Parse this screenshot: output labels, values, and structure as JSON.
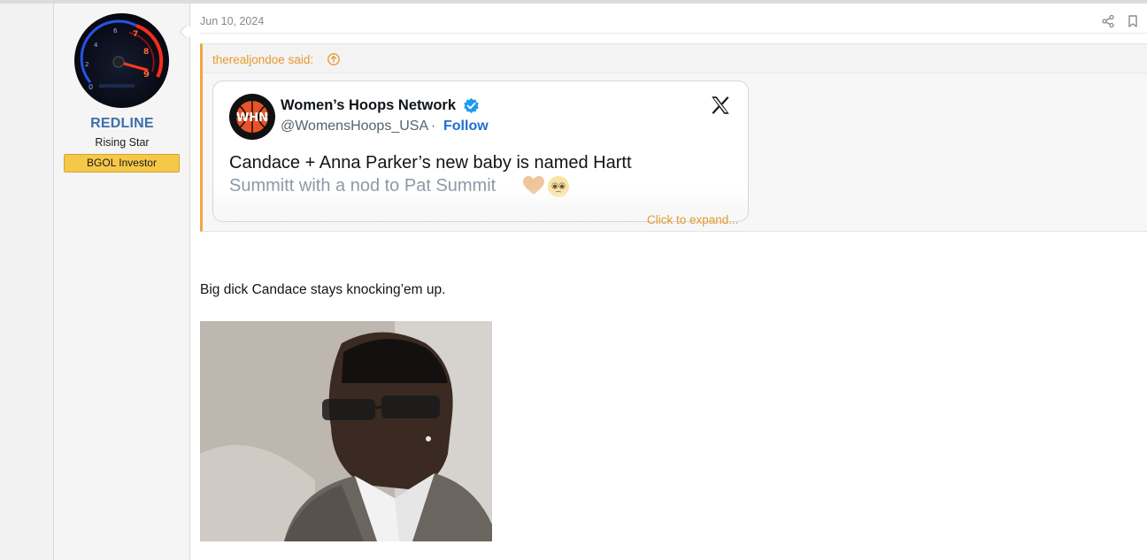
{
  "post": {
    "date": "Jun 10, 2024",
    "body_text": "Big dick Candace stays knocking’em up."
  },
  "user": {
    "name": "REDLINE",
    "title": "Rising Star",
    "banner": "BGOL Investor"
  },
  "quote": {
    "author_said": "therealjondoe said:",
    "expand_label": "Click to expand..."
  },
  "tweet": {
    "display_name": "Women’s Hoops Network",
    "handle": "@WomensHoops_USA",
    "separator": "·",
    "follow_label": "Follow",
    "text_line1": "Candace + Anna Parker’s new baby is named Hartt",
    "text_line2": "Summitt with a nod to Pat Summit",
    "logo_text": "WHN"
  },
  "icons": {
    "share": "share-icon",
    "bookmark": "bookmark-icon",
    "quote_jump": "arrow-up-circle-icon",
    "verified": "verified-badge-icon",
    "platform": "x-logo-icon"
  },
  "colors": {
    "accent_orange": "#f0a63d",
    "username_blue": "#3d6fa8",
    "banner_yellow": "#f5c84a",
    "follow_blue": "#1d6fd1"
  }
}
